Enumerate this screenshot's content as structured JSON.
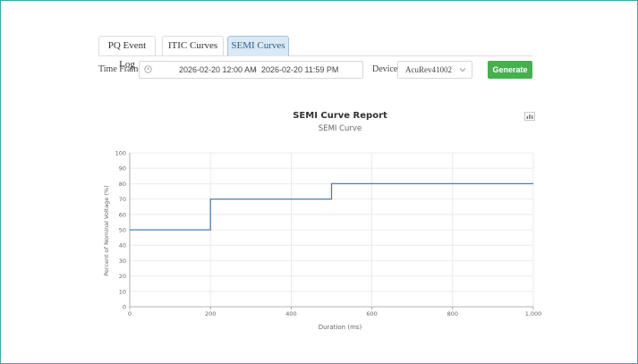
{
  "tabs": [
    {
      "label": "PQ Event Log"
    },
    {
      "label": "ITIC Curves"
    },
    {
      "label": "SEMI Curves",
      "active": true
    }
  ],
  "filters": {
    "time_frame_label": "Time Frame:",
    "start": "2026-02-20 12:00 AM",
    "separator": "-",
    "end": "2026-02-20 11:59 PM",
    "device_label": "Device",
    "device_value": "AcuRev41002",
    "generate_label": "Generate"
  },
  "icons": {
    "time": "clock-icon",
    "device_dropdown": "chevron-down-icon",
    "chart_menu": "chart-menu-icon"
  },
  "colors": {
    "accent_green": "#46b04f",
    "active_tab": "#dbe9f5",
    "series_line": "#4a7fb5",
    "frame_border": "#3aa8a8"
  },
  "chart_data": {
    "type": "line",
    "title": "SEMI Curve Report",
    "subtitle": "SEMI Curve",
    "xlabel": "Duration (ms)",
    "ylabel": "Percent of Nominal Voltage (%)",
    "xlim": [
      0,
      1000
    ],
    "ylim": [
      0,
      100
    ],
    "x_ticks": [
      "0",
      "200",
      "400",
      "600",
      "800",
      "1,000"
    ],
    "y_ticks": [
      "0",
      "10",
      "20",
      "30",
      "40",
      "50",
      "60",
      "70",
      "80",
      "90",
      "100"
    ],
    "grid": true,
    "series": [
      {
        "x": [
          0,
          200,
          200,
          500,
          500,
          1000
        ],
        "y": [
          50,
          50,
          70,
          70,
          80,
          80
        ]
      }
    ]
  }
}
